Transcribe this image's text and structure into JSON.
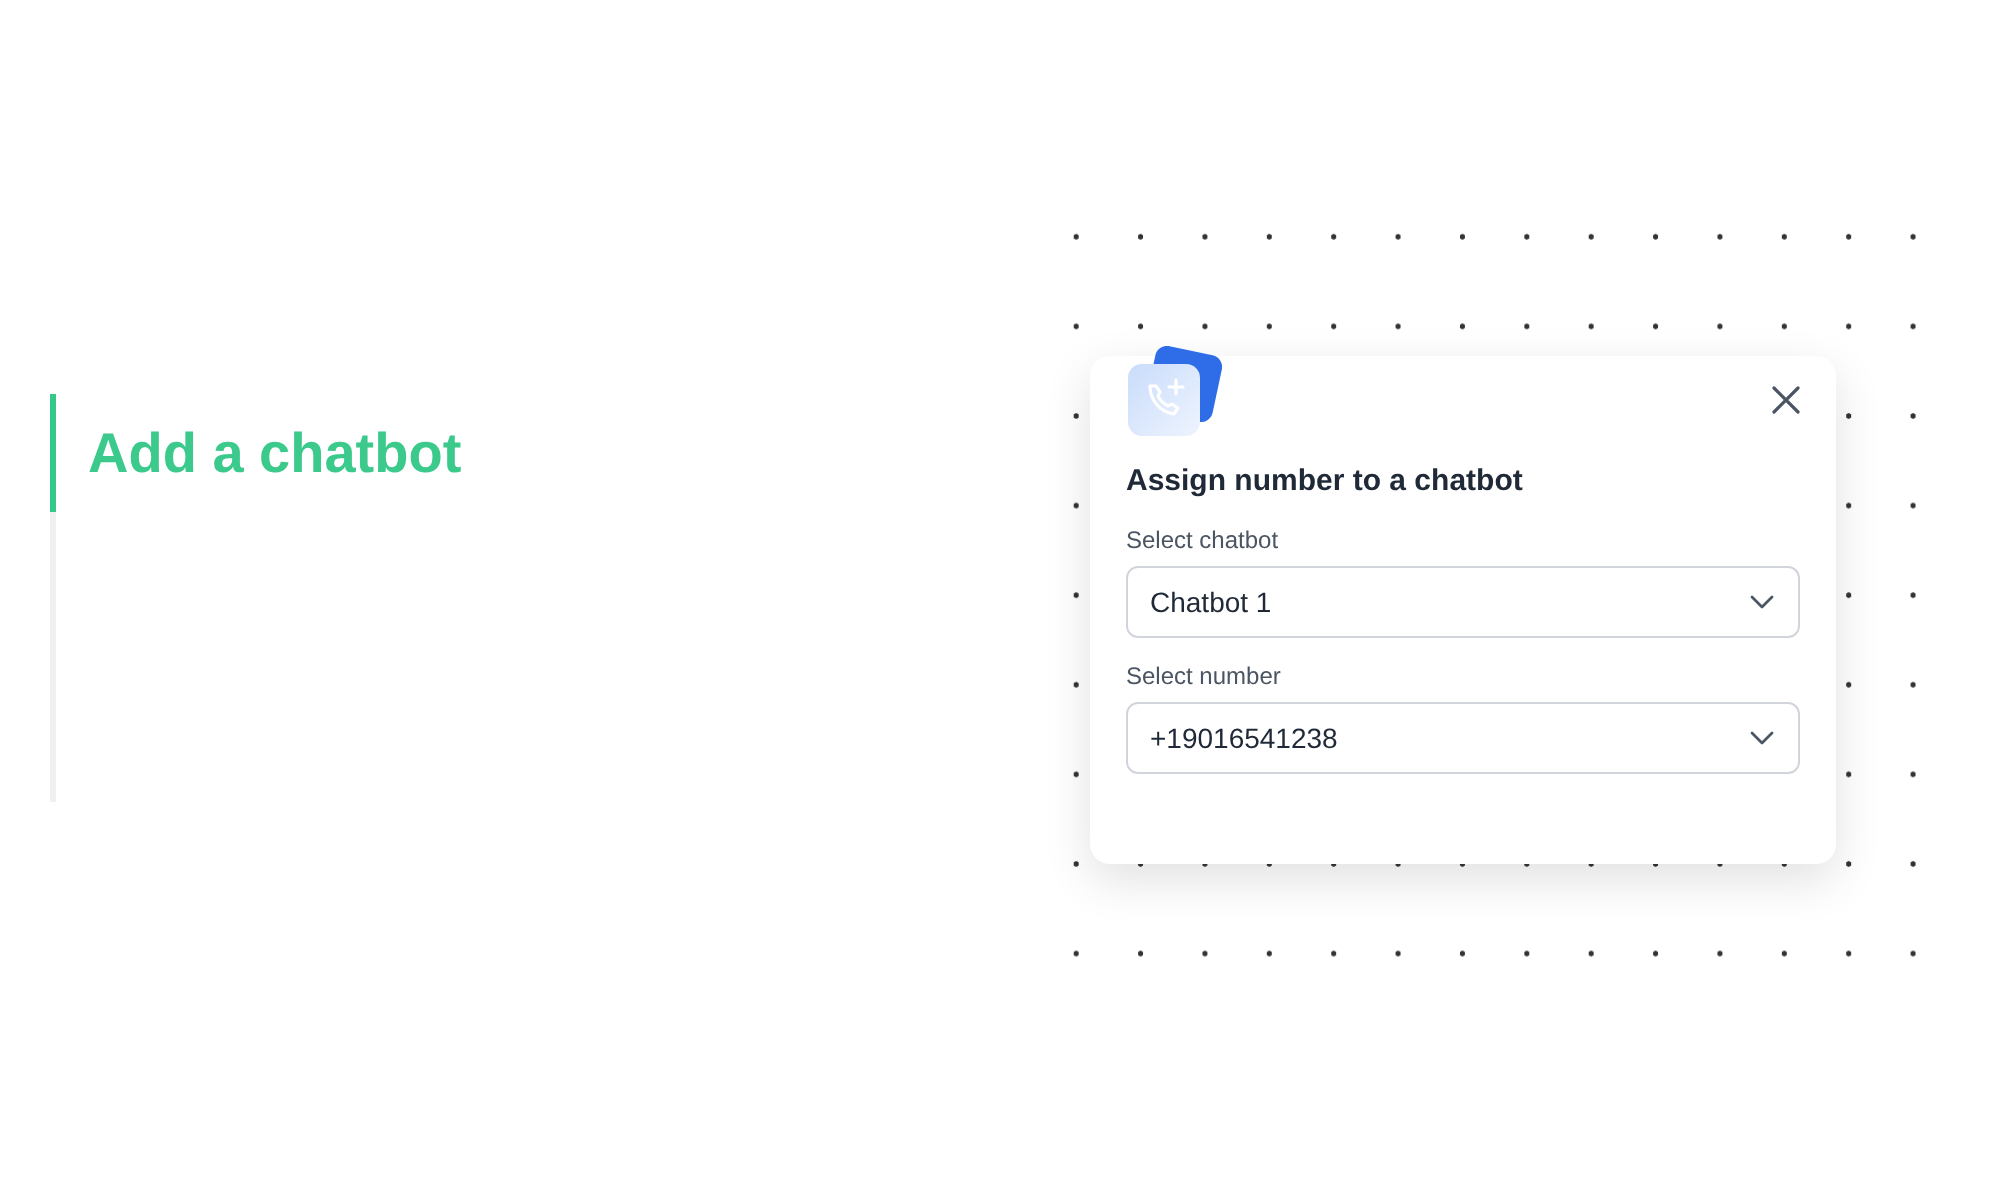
{
  "step": {
    "title": "Add a chatbot",
    "active": true
  },
  "dialog": {
    "title": "Assign number to a chatbot",
    "fields": [
      {
        "label": "Select chatbot",
        "value": "Chatbot 1"
      },
      {
        "label": "Select number",
        "value": "+19016541238"
      }
    ]
  }
}
